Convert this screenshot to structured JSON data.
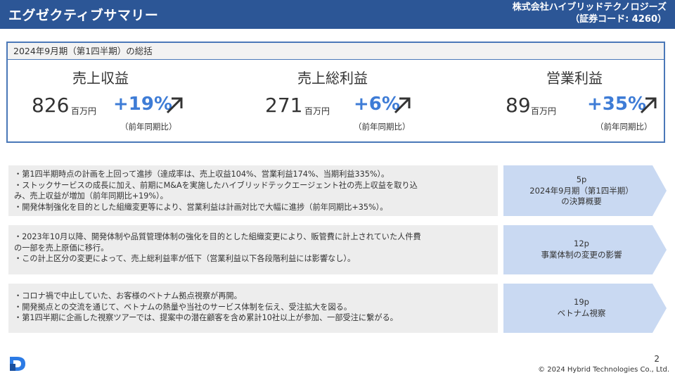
{
  "header": {
    "title": "エグゼクティブサマリー",
    "company_line1": "株式会社ハイブリッドテクノロジーズ",
    "company_line2": "（証券コード: 4260）"
  },
  "summary": {
    "heading": "2024年9月期（第1四半期）の総括",
    "kpis": [
      {
        "label": "売上収益",
        "value": "826",
        "unit": "百万円",
        "change": "+19%",
        "yoy": "（前年同期比）"
      },
      {
        "label": "売上総利益",
        "value": "271",
        "unit": "百万円",
        "change": "+6%",
        "yoy": "（前年同期比）"
      },
      {
        "label": "営業利益",
        "value": "89",
        "unit": "百万円",
        "change": "+35%",
        "yoy": "（前年同期比）"
      }
    ]
  },
  "sections": [
    {
      "lines": [
        "・第1四半期時点の計画を上回って進捗（達成率は、売上収益104%、営業利益174%、当期利益335%）。",
        "・ストックサービスの成長に加え、前期にM&Aを実施したハイブリッドテックエージェント社の売上収益を取り込",
        "み、売上収益が増加（前年同期比+19%）。",
        "・開発体制強化を目的とした組織変更等により、営業利益は計画対比で大幅に進捗（前年同期比+35%）。"
      ],
      "ref": [
        "5p",
        "2024年9月期（第1四半期）",
        "の決算概要"
      ]
    },
    {
      "lines": [
        "・2023年10月以降、開発体制や品質管理体制の強化を目的とした組織変更により、販管費に計上されていた人件費",
        "の一部を売上原価に移行。",
        "・この計上区分の変更によって、売上総利益率が低下（営業利益以下各段階利益には影響なし）。"
      ],
      "ref": [
        "12p",
        "事業体制の変更の影響"
      ]
    },
    {
      "lines": [
        "・コロナ禍で中止していた、お客様のベトナム拠点視察が再開。",
        "・開発拠点との交流を通じて、ベトナムの熱量や当社のサービス体制を伝え、受注拡大を図る。",
        "・第1四半期に企画した視察ツアーでは、提案中の潜在顧客を含め累計10社以上が参加、一部受注に繋がる。"
      ],
      "ref": [
        "19p",
        "ベトナム視察"
      ]
    }
  ],
  "footer": {
    "page": "2",
    "copyright": "© 2024 Hybrid Technologies Co., Ltd."
  },
  "colors": {
    "header_bg": "#2c5696",
    "accent": "#3e7cd6",
    "tag_bg": "#c9d9f2",
    "row_bg": "#ededed"
  },
  "icons": {
    "trend": "arrow-up-right-icon",
    "logo": "company-logo-icon"
  }
}
